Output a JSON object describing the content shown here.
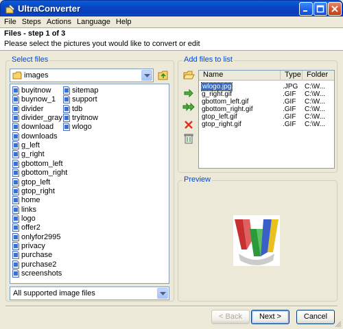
{
  "window": {
    "title": "UltraConverter"
  },
  "menu": [
    "File",
    "Steps",
    "Actions",
    "Language",
    "Help"
  ],
  "header": {
    "step_title": "Files - step 1 of 3",
    "step_desc": "Please select the pictures yout would like to convert or edit"
  },
  "select_files": {
    "label": "Select files",
    "folder": "images",
    "filter": "All supported image files",
    "col1": [
      "buyitnow",
      "buynow_1",
      "divider",
      "divider_gray",
      "download",
      "downloads",
      "g_left",
      "g_right",
      "gbottom_left",
      "gbottom_right",
      "gtop_left",
      "gtop_right",
      "home",
      "links",
      "logo",
      "offer2",
      "onlyfor2995",
      "privacy",
      "purchase",
      "purchase2",
      "screenshots"
    ],
    "col2": [
      "sitemap",
      "support",
      "tdb",
      "tryitnow",
      "wlogo"
    ]
  },
  "add_files": {
    "label": "Add files to list",
    "columns": [
      "Name",
      "Type",
      "Folder"
    ],
    "rows": [
      {
        "name": "wlogo.jpg",
        "type": ".JPG",
        "folder": "C:\\W...",
        "selected": true
      },
      {
        "name": "g_right.gif",
        "type": ".GIF",
        "folder": "C:\\W..."
      },
      {
        "name": "gbottom_left.gif",
        "type": ".GIF",
        "folder": "C:\\W..."
      },
      {
        "name": "gbottom_right.gif",
        "type": ".GIF",
        "folder": "C:\\W..."
      },
      {
        "name": "gtop_left.gif",
        "type": ".GIF",
        "folder": "C:\\W..."
      },
      {
        "name": "gtop_right.gif",
        "type": ".GIF",
        "folder": "C:\\W..."
      }
    ]
  },
  "preview": {
    "label": "Preview"
  },
  "buttons": {
    "back": "< Back",
    "next": "Next >",
    "cancel": "Cancel"
  },
  "colors": {
    "title_bar": "#0a4fd0",
    "group_label": "#0046d5",
    "selection": "#316ac5"
  }
}
